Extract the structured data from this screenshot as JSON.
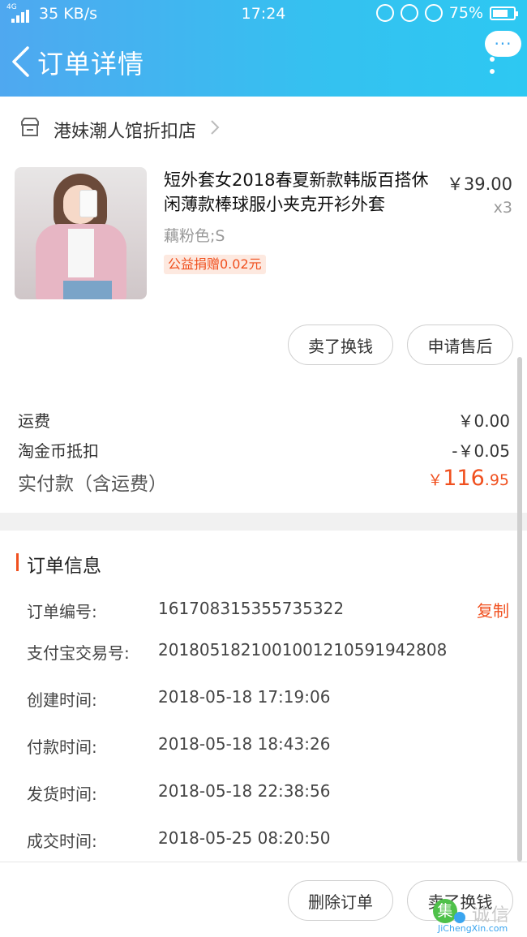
{
  "status_bar": {
    "network": "4G",
    "speed": "35 KB/s",
    "time": "17:24",
    "battery": "75%",
    "battery_level": 0.75
  },
  "nav": {
    "title": "订单详情",
    "more_label": "···"
  },
  "shop": {
    "name": "港妹潮人馆折扣店"
  },
  "product": {
    "title": "短外套女2018春夏新款韩版百搭休闲薄款棒球服小夹克开衫外套",
    "price": "￥39.00",
    "quantity": "x3",
    "sku": "藕粉色;S",
    "tag": "公益捐赠0.02元"
  },
  "item_actions": {
    "sell_label": "卖了换钱",
    "after_sale_label": "申请售后"
  },
  "fees": {
    "shipping_label": "运费",
    "shipping_value": "￥0.00",
    "coin_label": "淘金币抵扣",
    "coin_value": "-￥0.05",
    "total_label": "实付款（含运费）",
    "total_currency": "￥",
    "total_int": "116",
    "total_dec": ".95"
  },
  "order_info": {
    "title": "订单信息",
    "copy_label": "复制",
    "rows": [
      {
        "label": "订单编号:",
        "value": "161708315355735322"
      },
      {
        "label": "支付宝交易号:",
        "value": "2018051821001001210591942808"
      },
      {
        "label": "创建时间:",
        "value": "2018-05-18 17:19:06"
      },
      {
        "label": "付款时间:",
        "value": "2018-05-18 18:43:26"
      },
      {
        "label": "发货时间:",
        "value": "2018-05-18 22:38:56"
      },
      {
        "label": "成交时间:",
        "value": "2018-05-25 08:20:50"
      }
    ]
  },
  "bottom": {
    "delete_label": "删除订单",
    "sell_label": "卖了换钱"
  },
  "watermark": {
    "logo_char": "集",
    "text": "诚信",
    "sub": "JiChengXin.com"
  },
  "colors": {
    "header_start": "#4fa8f0",
    "header_end": "#2dc8f2",
    "accent": "#f0501f"
  }
}
